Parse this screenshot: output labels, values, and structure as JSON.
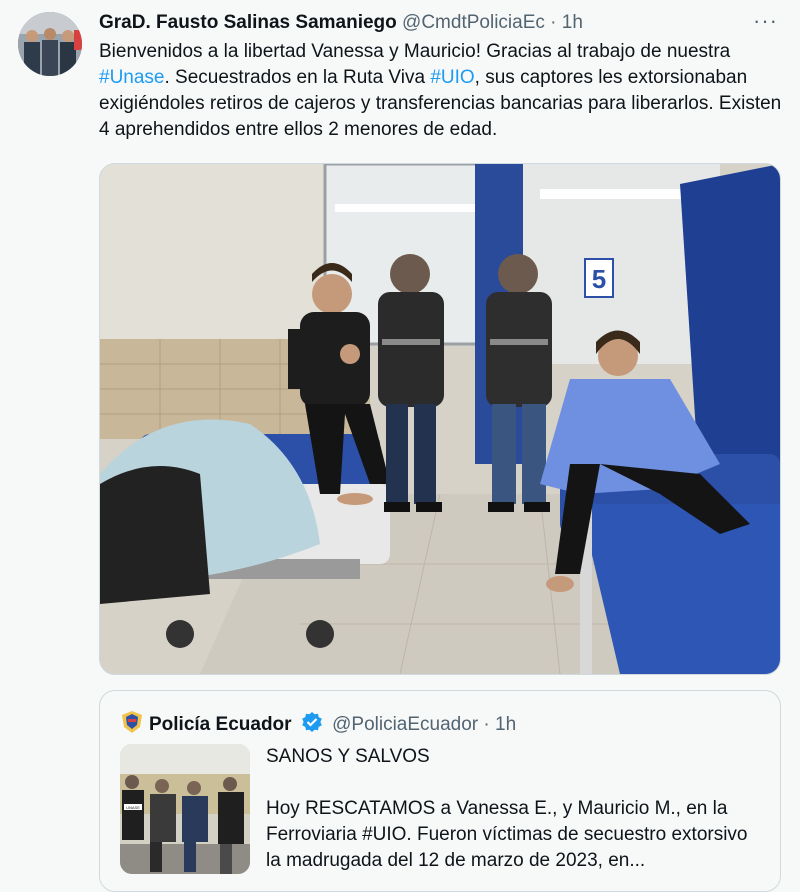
{
  "tweet": {
    "author_name": "GraD. Fausto Salinas Samaniego",
    "handle": "@CmdtPoliciaEc",
    "separator": "·",
    "time": "1h",
    "more_label": "···",
    "text_parts": [
      "Bienvenidos a la libertad Vanessa y Mauricio! Gracias al trabajo de nuestra ",
      "#Unase",
      ". Secuestrados en la Ruta Viva ",
      "#UIO",
      ", sus captores les extorsionaban exigiéndoles retiros de cajeros y transferencias bancarias para liberarlos. Existen 4 aprehendidos entre ellos 2 menores de edad."
    ],
    "media_sign": "5"
  },
  "quote": {
    "author_name": "Policía Ecuador",
    "handle": "@PoliciaEcuador",
    "separator": "·",
    "time": "1h",
    "title": "SANOS Y SALVOS",
    "body": "Hoy RESCATAMOS  a Vanessa E., y Mauricio M., en la Ferroviaria #UIO. Fueron víctimas de secuestro extorsivo la madrugada del 12 de marzo de 2023, en...",
    "thumb_label": "UNASE"
  },
  "colors": {
    "accent": "#1d9bf0",
    "muted": "#536471",
    "hospital_blue": "#2c4fa8"
  }
}
